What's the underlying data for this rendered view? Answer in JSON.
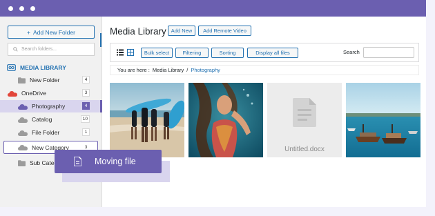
{
  "colors": {
    "accent": "#6b5fb0",
    "link": "#2271b1",
    "sidebar_bg": "#f1f1f1",
    "onedrive_icon": "#e2463a",
    "folder_selected": "#6b5fb0",
    "folder_grey": "#9b9b9b"
  },
  "sidebar": {
    "add_folder_label": "Add New Folder",
    "search_placeholder": "Search folders...",
    "media_library_label": "MEDIA LIBRARY",
    "items": [
      {
        "label": "New Folder",
        "icon": "folder-icon",
        "count": "4"
      },
      {
        "label": "OneDrive",
        "icon": "onedrive-cloud-icon",
        "count": "3"
      },
      {
        "label": "Photography",
        "icon": "cloud-icon",
        "count": "4",
        "selected": true
      },
      {
        "label": "Catalog",
        "icon": "cloud-icon",
        "count": "10"
      },
      {
        "label": "File Folder",
        "icon": "cloud-icon",
        "count": "1"
      },
      {
        "label": "New Category",
        "icon": "cloud-icon",
        "count": "3",
        "outlined": true
      },
      {
        "label": "Sub Category",
        "icon": "folder-icon",
        "visible_text": "Sub Categ"
      }
    ]
  },
  "main": {
    "title": "Media Library",
    "add_new_label": "Add New",
    "add_remote_video_label": "Add Remote Video",
    "toolbar": {
      "list_view_icon": "list-view-icon",
      "grid_view_icon": "grid-view-icon",
      "bulk_select_label": "Bulk select",
      "filtering_label": "Filtering",
      "sorting_label": "Sorting",
      "display_all_label": "Display all files",
      "search_label": "Search"
    },
    "breadcrumb": {
      "prefix": "You are here :",
      "root": "Media Library",
      "separator": "/",
      "current": "Photography"
    },
    "files": [
      {
        "type": "image",
        "description": "surfers on beach"
      },
      {
        "type": "image",
        "description": "underwater portrait"
      },
      {
        "type": "document",
        "name": "Untitled.docx"
      },
      {
        "type": "image",
        "description": "boats on turquoise sea"
      }
    ]
  },
  "drag": {
    "label": "Moving file",
    "icon": "document-icon"
  }
}
